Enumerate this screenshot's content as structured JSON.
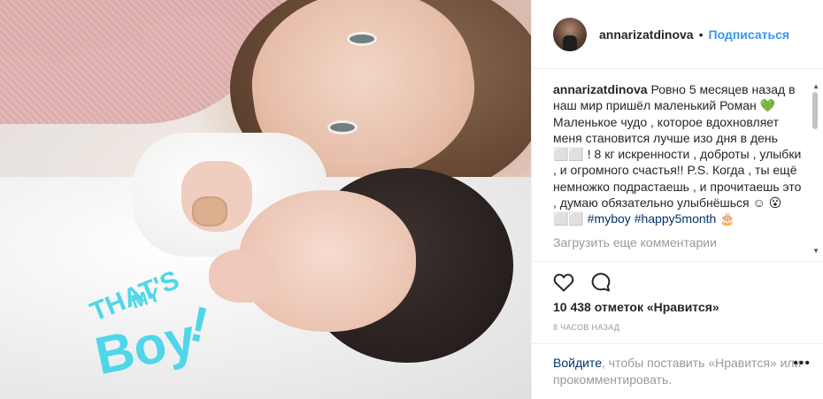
{
  "photo": {
    "sticker_text": [
      "THAT'S",
      "MY",
      "Boy",
      "!"
    ],
    "sticker_color": "#4fd6ea"
  },
  "header": {
    "username": "annarizatdinova",
    "separator": "•",
    "follow_label": "Подписаться",
    "follow_color": "#3897f0"
  },
  "caption": {
    "username": "annarizatdinova",
    "text": "Ровно 5 месяцев назад в наш мир пришёл маленький Роман 💚 Маленькое чудо , которое вдохновляет меня становится лучше изо дня в день ⬜⬜ ! 8 кг искренности , доброты , улыбки , и огромного счастья!! P.S. Когда , ты ещё немножко подрастаешь , и прочитаешь это , думаю обязательно улыбнёшься ☺ 😮⬜⬜",
    "hashtag1": "#myboy",
    "hashtag2": "#happy5month",
    "trailing_emoji": "🎂"
  },
  "load_more": "Загрузить еще комментарии",
  "actions": {
    "like_icon": "heart-icon",
    "comment_icon": "speech-bubble-icon",
    "likes_text": "10 438 отметок «Нравится»",
    "timestamp": "8 ЧАСОВ НАЗАД"
  },
  "footer": {
    "login_label": "Войдите",
    "prompt": ", чтобы поставить «Нравится» или прокомментировать.",
    "more_icon": "more-options-icon",
    "more_label": "•••"
  },
  "scrollbar": {
    "up_glyph": "▲",
    "down_glyph": "▼"
  }
}
